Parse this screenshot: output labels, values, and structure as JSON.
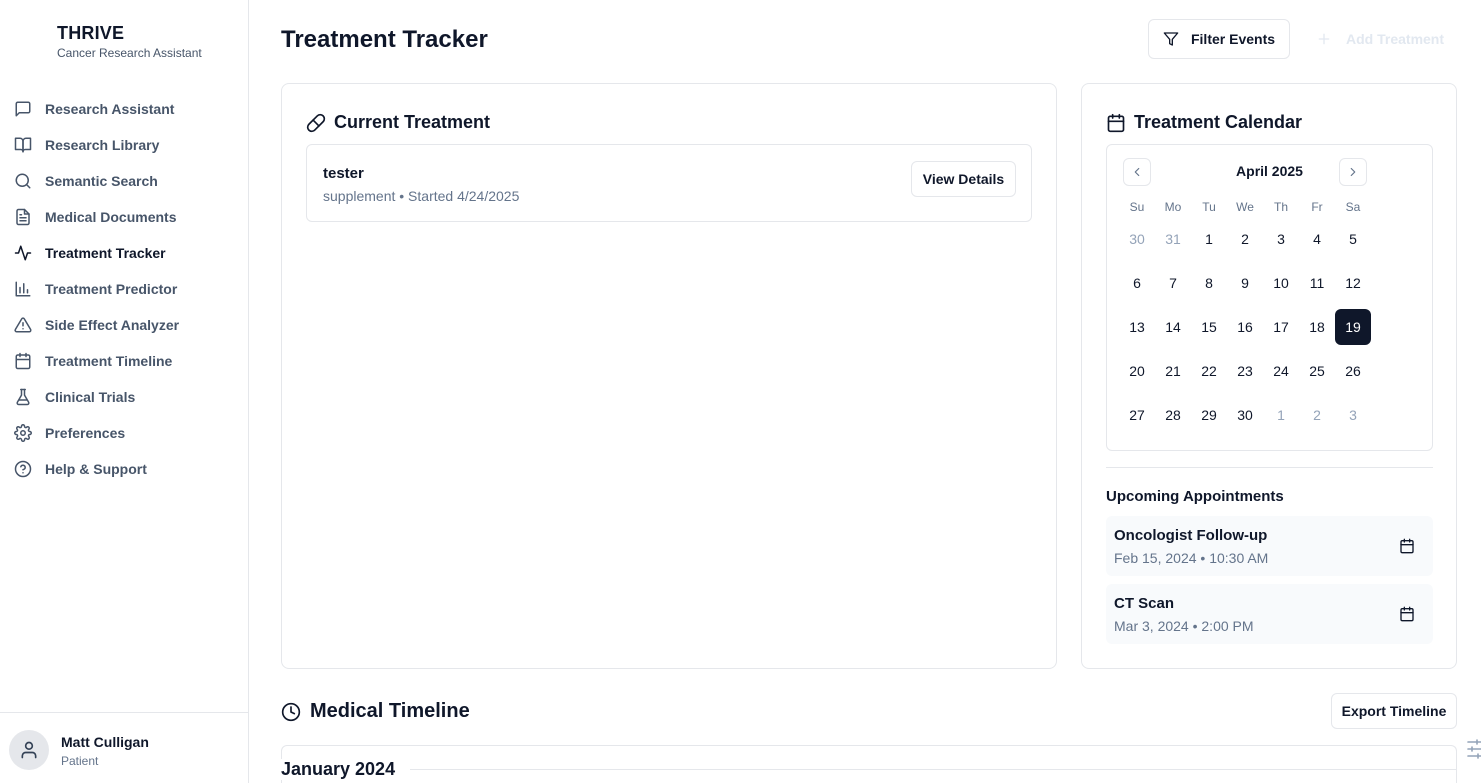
{
  "brand": {
    "title": "THRIVE",
    "subtitle": "Cancer Research Assistant"
  },
  "sidebar": {
    "items": [
      {
        "label": "Research Assistant",
        "icon": "message-square-icon"
      },
      {
        "label": "Research Library",
        "icon": "book-open-icon"
      },
      {
        "label": "Semantic Search",
        "icon": "search-icon"
      },
      {
        "label": "Medical Documents",
        "icon": "file-text-icon"
      },
      {
        "label": "Treatment Tracker",
        "icon": "activity-icon",
        "active": true
      },
      {
        "label": "Treatment Predictor",
        "icon": "bar-chart-icon"
      },
      {
        "label": "Side Effect Analyzer",
        "icon": "alert-triangle-icon"
      },
      {
        "label": "Treatment Timeline",
        "icon": "calendar-icon"
      },
      {
        "label": "Clinical Trials",
        "icon": "flask-icon"
      },
      {
        "label": "Preferences",
        "icon": "gear-icon"
      },
      {
        "label": "Help & Support",
        "icon": "help-circle-icon"
      }
    ],
    "user": {
      "name": "Matt Culligan",
      "role": "Patient"
    }
  },
  "header": {
    "title": "Treatment Tracker",
    "filter_label": "Filter Events",
    "add_label": "Add Treatment"
  },
  "current_treatment": {
    "title": "Current Treatment",
    "item": {
      "name": "tester",
      "meta": "supplement • Started 4/24/2025",
      "button": "View Details"
    }
  },
  "calendar": {
    "title": "Treatment Calendar",
    "month_label": "April 2025",
    "weekdays": [
      "Su",
      "Mo",
      "Tu",
      "We",
      "Th",
      "Fr",
      "Sa"
    ],
    "days": [
      {
        "d": "30",
        "o": true
      },
      {
        "d": "31",
        "o": true
      },
      {
        "d": "1"
      },
      {
        "d": "2"
      },
      {
        "d": "3"
      },
      {
        "d": "4"
      },
      {
        "d": "5"
      },
      {
        "d": "6"
      },
      {
        "d": "7"
      },
      {
        "d": "8"
      },
      {
        "d": "9"
      },
      {
        "d": "10"
      },
      {
        "d": "11"
      },
      {
        "d": "12"
      },
      {
        "d": "13"
      },
      {
        "d": "14"
      },
      {
        "d": "15"
      },
      {
        "d": "16"
      },
      {
        "d": "17"
      },
      {
        "d": "18"
      },
      {
        "d": "19",
        "s": true
      },
      {
        "d": "20"
      },
      {
        "d": "21"
      },
      {
        "d": "22"
      },
      {
        "d": "23"
      },
      {
        "d": "24"
      },
      {
        "d": "25"
      },
      {
        "d": "26"
      },
      {
        "d": "27"
      },
      {
        "d": "28"
      },
      {
        "d": "29"
      },
      {
        "d": "30"
      },
      {
        "d": "1",
        "o": true
      },
      {
        "d": "2",
        "o": true
      },
      {
        "d": "3",
        "o": true
      }
    ]
  },
  "appointments": {
    "heading": "Upcoming Appointments",
    "items": [
      {
        "title": "Oncologist Follow-up",
        "time": "Feb 15, 2024 • 10:30 AM"
      },
      {
        "title": "CT Scan",
        "time": "Mar 3, 2024 • 2:00 PM"
      }
    ]
  },
  "timeline": {
    "title": "Medical Timeline",
    "export_label": "Export Timeline",
    "month": "January 2024"
  }
}
